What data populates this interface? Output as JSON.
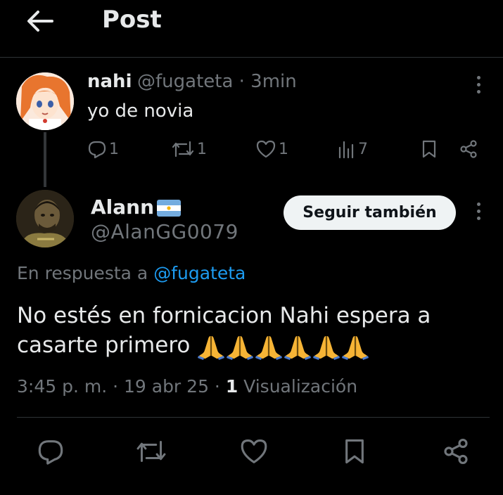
{
  "header": {
    "title": "Post",
    "back_icon": "arrow-left-icon"
  },
  "original_post": {
    "display_name": "nahi",
    "meta": "@fugateta · 3min",
    "text": "yo de novia",
    "actions": {
      "replies": "1",
      "reposts": "1",
      "likes": "1",
      "views": "7"
    }
  },
  "reply_post": {
    "display_name": "Alann",
    "handle": "@AlanGG0079",
    "follow_label": "Seguir también",
    "reply_prefix": "En respuesta a ",
    "reply_mention": "@fugateta",
    "text": "No estés en fornicacion Nahi espera a casarte primero",
    "emoji": "🙏🙏🙏🙏🙏🙏",
    "time": "3:45 p. m. · 19 abr 25 · ",
    "views_count": "1",
    "views_label": " Visualización"
  },
  "colors": {
    "background": "#000000",
    "text": "#e7e9ea",
    "muted": "#71767b",
    "accent": "#1d9bf0",
    "divider": "#2f3336"
  }
}
